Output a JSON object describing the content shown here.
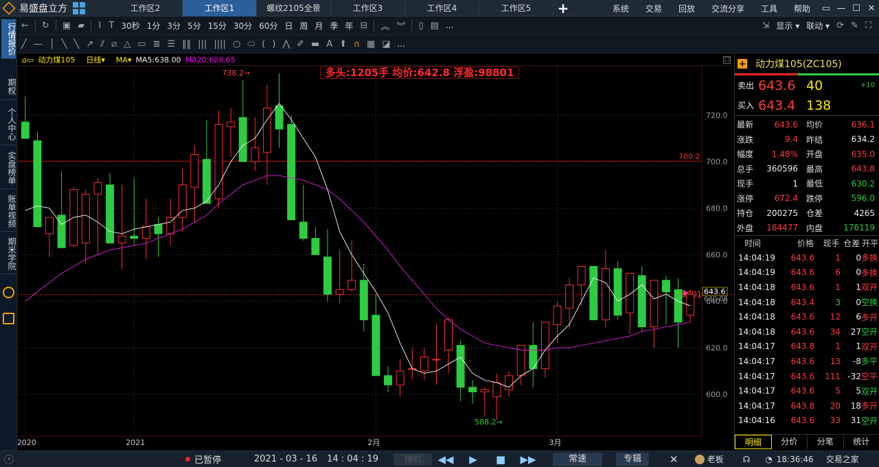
{
  "app": {
    "name": "易盛盘立方"
  },
  "tabs": [
    "工作区2",
    "工作区1",
    "螺纹2105全景",
    "工作区3",
    "工作区4",
    "工作区5"
  ],
  "active_tab": 1,
  "menu": [
    "系统",
    "交易",
    "回放",
    "交流分享",
    "工具",
    "帮助"
  ],
  "sidebar": [
    "行情报价",
    "期权",
    "个人中心",
    "实盘榜单",
    "账单视频",
    "期米学院"
  ],
  "toolbar1": {
    "periods": [
      "30秒",
      "1分",
      "3分",
      "5分",
      "15分",
      "30分",
      "60分",
      "日",
      "周",
      "月",
      "季",
      "年"
    ],
    "more": "...",
    "display": "显示",
    "link": "联动"
  },
  "toolbar2": {
    "more": "..."
  },
  "chart_header": {
    "symbol": "动力煤105",
    "period": "日线",
    "indicator": "MA",
    "ma5": "MA5:638.00",
    "ma20": "MA20:628.65"
  },
  "position_box": "多头:1205手 均价:642.8 浮盈:98801",
  "chart_data": {
    "type": "candlestick",
    "title": "动力煤105",
    "ylim": [
      582,
      740
    ],
    "yticks": [
      "720.0",
      "700.0",
      "680.0",
      "660.0",
      "640.0",
      "620.0",
      "600.0"
    ],
    "yticks_v": [
      720,
      700,
      680,
      660,
      640,
      620,
      600
    ],
    "xlabels": [
      {
        "text": "2020",
        "i": 0
      },
      {
        "text": "2021",
        "i": 9
      },
      {
        "text": "2月",
        "i": 29
      },
      {
        "text": "3月",
        "i": 44
      }
    ],
    "hline": {
      "value": 700.2,
      "label": "700.2"
    },
    "avg_line": {
      "value": 642.8,
      "label": "98801"
    },
    "last_price": {
      "value": 643.6,
      "label": "643.6",
      "sub": "640.08"
    },
    "max_label": {
      "value": 738.2,
      "label": "738.2",
      "i": 19
    },
    "min_label": {
      "value": 588.2,
      "label": "588.2",
      "i": 40
    },
    "candles": [
      [
        717,
        728,
        710,
        710
      ],
      [
        709,
        713,
        672,
        672
      ],
      [
        669,
        676,
        659,
        676
      ],
      [
        677,
        696,
        663,
        663
      ],
      [
        664,
        689,
        663,
        688
      ],
      [
        665,
        688,
        656,
        686
      ],
      [
        686,
        693,
        660,
        691
      ],
      [
        690,
        695,
        665,
        665
      ],
      [
        665,
        690,
        654,
        668
      ],
      [
        668,
        693,
        664,
        667
      ],
      [
        667,
        684,
        658,
        672
      ],
      [
        673,
        676,
        659,
        669
      ],
      [
        669,
        684,
        664,
        676
      ],
      [
        676,
        697,
        670,
        690
      ],
      [
        689,
        707,
        674,
        703
      ],
      [
        701,
        718,
        686,
        682
      ],
      [
        684,
        722,
        680,
        716
      ],
      [
        715,
        723,
        702,
        717
      ],
      [
        719,
        735,
        701,
        700
      ],
      [
        700,
        719,
        696,
        706
      ],
      [
        704,
        733,
        690,
        723
      ],
      [
        724,
        738,
        706,
        714
      ],
      [
        716,
        720,
        675,
        675
      ],
      [
        674,
        690,
        666,
        667
      ],
      [
        667,
        672,
        660,
        660
      ],
      [
        659,
        671,
        640,
        643
      ],
      [
        643,
        662,
        639,
        645
      ],
      [
        645,
        666,
        644,
        649
      ],
      [
        649,
        656,
        627,
        632
      ],
      [
        634,
        643,
        608,
        608
      ],
      [
        608,
        612,
        601,
        604
      ],
      [
        604,
        615,
        599,
        610
      ],
      [
        611,
        620,
        606,
        611
      ],
      [
        610,
        620,
        606,
        616
      ],
      [
        615,
        630,
        604,
        615
      ],
      [
        619,
        633,
        609,
        632
      ],
      [
        621,
        623,
        597,
        603
      ],
      [
        603,
        606,
        596,
        601
      ],
      [
        601,
        603,
        591,
        602
      ],
      [
        599,
        609,
        589,
        605
      ],
      [
        602,
        610,
        599,
        608
      ],
      [
        608,
        616,
        604,
        621
      ],
      [
        621,
        631,
        603,
        611
      ],
      [
        611,
        628,
        607,
        631
      ],
      [
        630,
        640,
        622,
        638
      ],
      [
        637,
        650,
        628,
        647
      ],
      [
        647,
        651,
        638,
        655
      ],
      [
        655,
        655,
        633,
        632
      ],
      [
        632,
        662,
        629,
        654
      ],
      [
        654,
        657,
        632,
        634
      ],
      [
        635,
        651,
        626,
        652
      ],
      [
        651,
        655,
        627,
        629
      ],
      [
        629,
        649,
        620,
        649
      ],
      [
        649,
        651,
        630,
        644
      ],
      [
        645,
        650,
        620,
        631
      ],
      [
        634,
        645,
        631,
        643
      ]
    ],
    "ma5": [
      679,
      681,
      680,
      673,
      676,
      677,
      674,
      670,
      669,
      671,
      672,
      673,
      674,
      679,
      680,
      683,
      690,
      700,
      707,
      710,
      718,
      725,
      718,
      710,
      702,
      688,
      670,
      660,
      652,
      644,
      635,
      622,
      611,
      609,
      610,
      613,
      616,
      609,
      606,
      605,
      603,
      608,
      611,
      619,
      625,
      630,
      640,
      650,
      648,
      640,
      643,
      647,
      641,
      643,
      640,
      638
    ],
    "ma20": [
      640,
      644,
      648,
      652,
      655,
      658,
      660,
      662,
      663,
      664,
      665,
      667,
      669,
      671,
      674,
      677,
      682,
      686,
      690,
      692,
      694,
      694,
      693,
      692,
      690,
      688,
      684,
      679,
      674,
      668,
      662,
      655,
      649,
      643,
      637,
      632,
      628,
      625,
      622,
      621,
      620,
      619,
      619,
      619,
      620,
      620,
      621,
      622,
      623,
      624,
      625,
      627,
      628,
      629,
      630,
      631
    ]
  },
  "right_panel": {
    "title": "动力煤105(ZC105)",
    "sell": {
      "label": "卖出",
      "price": "643.6",
      "vol": "40",
      "chg": "+10"
    },
    "buy": {
      "label": "买入",
      "price": "643.4",
      "vol": "138"
    },
    "rows": [
      {
        "k": "最新",
        "v": "643.6",
        "vc": "red",
        "k2": "均价",
        "v2": "636.1",
        "v2c": "red"
      },
      {
        "k": "涨跌",
        "v": "9.4",
        "vc": "red",
        "k2": "昨结",
        "v2": "634.2",
        "v2c": "wht"
      },
      {
        "k": "幅度",
        "v": "1.48%",
        "vc": "red",
        "k2": "开盘",
        "v2": "635.0",
        "v2c": "red"
      },
      {
        "k": "总手",
        "v": "360596",
        "vc": "wht",
        "k2": "最高",
        "v2": "643.8",
        "v2c": "red"
      },
      {
        "k": "现手",
        "v": "1",
        "vc": "wht",
        "k2": "最低",
        "v2": "630.2",
        "v2c": "grn"
      },
      {
        "k": "涨停",
        "v": "672.4",
        "vc": "red",
        "k2": "跌停",
        "v2": "596.0",
        "v2c": "grn"
      },
      {
        "k": "持仓",
        "v": "200275",
        "vc": "wht",
        "k2": "仓差",
        "v2": "4265",
        "v2c": "wht"
      },
      {
        "k": "外盘",
        "v": "184477",
        "vc": "red",
        "k2": "内盘",
        "v2": "176119",
        "v2c": "grn"
      }
    ],
    "tick_headers": [
      "时间",
      "价格",
      "现手",
      "仓差",
      "开平"
    ],
    "ticks": [
      [
        "14:04:19",
        "643.6",
        "1",
        "0",
        "多换",
        "red",
        "red"
      ],
      [
        "14:04:19",
        "643.6",
        "6",
        "0",
        "多换",
        "red",
        "red"
      ],
      [
        "14:04:18",
        "643.6",
        "1",
        "1",
        "双开",
        "red",
        "red"
      ],
      [
        "14:04:18",
        "643.4",
        "3",
        "0",
        "空换",
        "grn",
        "grn"
      ],
      [
        "14:04:18",
        "643.6",
        "12",
        "6",
        "多开",
        "red",
        "red"
      ],
      [
        "14:04:18",
        "643.6",
        "34",
        "27",
        "空开",
        "red",
        "grn"
      ],
      [
        "14:04:17",
        "643.8",
        "1",
        "1",
        "双开",
        "red",
        "red"
      ],
      [
        "14:04:17",
        "643.6",
        "13",
        "-8",
        "多平",
        "red",
        "grn"
      ],
      [
        "14:04:17",
        "643.6",
        "111",
        "-32",
        "空平",
        "red",
        "red"
      ],
      [
        "14:04:17",
        "643.6",
        "5",
        "5",
        "双开",
        "red",
        "grn"
      ],
      [
        "14:04:17",
        "643.8",
        "20",
        "18",
        "多开",
        "red",
        "red"
      ],
      [
        "14:04:16",
        "643.6",
        "33",
        "31",
        "空开",
        "red",
        "grn"
      ]
    ],
    "bottom_tabs": [
      "明细",
      "分价",
      "分笔",
      "统计"
    ]
  },
  "status": {
    "paused": "已暂停",
    "date": "2021 - 03 - 16",
    "time": "14 : 04 : 19",
    "random": "随机",
    "speed": "常速",
    "edit": "专辑",
    "user": "老板",
    "clock": "18:36:46",
    "brand": "交易之家"
  }
}
